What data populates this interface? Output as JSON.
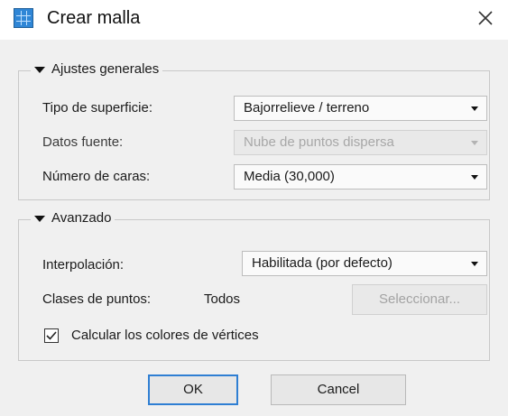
{
  "window": {
    "title": "Crear malla",
    "app_icon": "mesh-app-icon",
    "close_icon": "close-icon"
  },
  "general": {
    "legend": "Ajustes generales",
    "surface_label": "Tipo de superficie:",
    "surface_value": "Bajorrelieve / terreno",
    "source_label": "Datos fuente:",
    "source_value": "Nube de puntos dispersa",
    "faces_label": "Número de caras:",
    "faces_value": "Media (30,000)"
  },
  "advanced": {
    "legend": "Avanzado",
    "interp_label": "Interpolación:",
    "interp_value": "Habilitada (por defecto)",
    "classes_label": "Clases de puntos:",
    "classes_value": "Todos",
    "select_button": "Seleccionar...",
    "vertex_colors_label": "Calcular los colores de vértices",
    "vertex_colors_checked": true
  },
  "footer": {
    "ok": "OK",
    "cancel": "Cancel"
  },
  "colors": {
    "accent": "#2f7fd3",
    "app_icon": "#2f86d6",
    "dialog_bg": "#f0f0f0"
  }
}
